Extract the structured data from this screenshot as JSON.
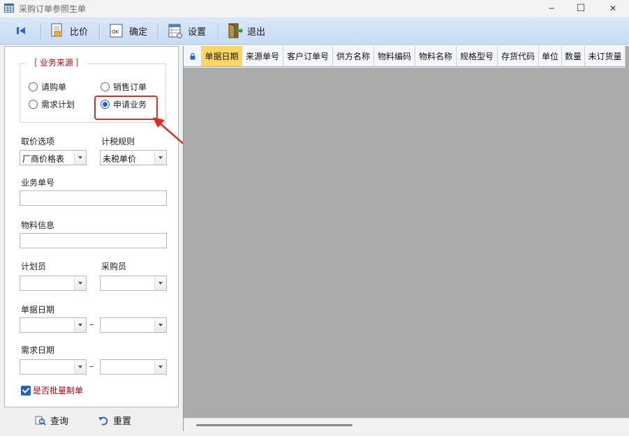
{
  "window": {
    "title": "采购订单参照生单",
    "minimize": "─",
    "maximize": "☐",
    "close": "✕"
  },
  "toolbar": {
    "compare": "比价",
    "confirm": "确定",
    "settings": "设置",
    "exit": "退出",
    "ok_icon_text": "OK"
  },
  "source_group": {
    "title": "｛ 业务来源 ｝",
    "options": {
      "purchase_request": "请购单",
      "sales_order": "销售订单",
      "demand_plan": "需求计划",
      "application": "申请业务"
    },
    "selected": "申请业务"
  },
  "form": {
    "price_option_label": "取价选项",
    "price_option_value": "厂商价格表",
    "tax_rule_label": "计税规则",
    "tax_rule_value": "未税单价",
    "doc_no_label": "业务单号",
    "doc_no_value": "",
    "material_label": "物料信息",
    "material_value": "",
    "planner_label": "计划员",
    "planner_value": "",
    "buyer_label": "采购员",
    "buyer_value": "",
    "doc_date_label": "单据日期",
    "doc_date_from": "",
    "doc_date_to": "",
    "range_sep": "–",
    "demand_date_label": "需求日期",
    "demand_date_from": "",
    "demand_date_to": "",
    "batch_label": "是否批量制单",
    "batch_checked": true
  },
  "bottom": {
    "query": "查询",
    "reset": "重置"
  },
  "grid": {
    "columns": [
      "单据日期",
      "来源单号",
      "客户订单号",
      "供方名称",
      "物料编码",
      "物料名称",
      "规格型号",
      "存货代码",
      "单位",
      "数量",
      "未订货量"
    ],
    "selected_column": "单据日期",
    "rows": []
  },
  "colors": {
    "accent": "#1e62c8",
    "highlight_box": "#e8291f",
    "selected_header": "#ffd75e",
    "grid_bg": "#ababab"
  }
}
